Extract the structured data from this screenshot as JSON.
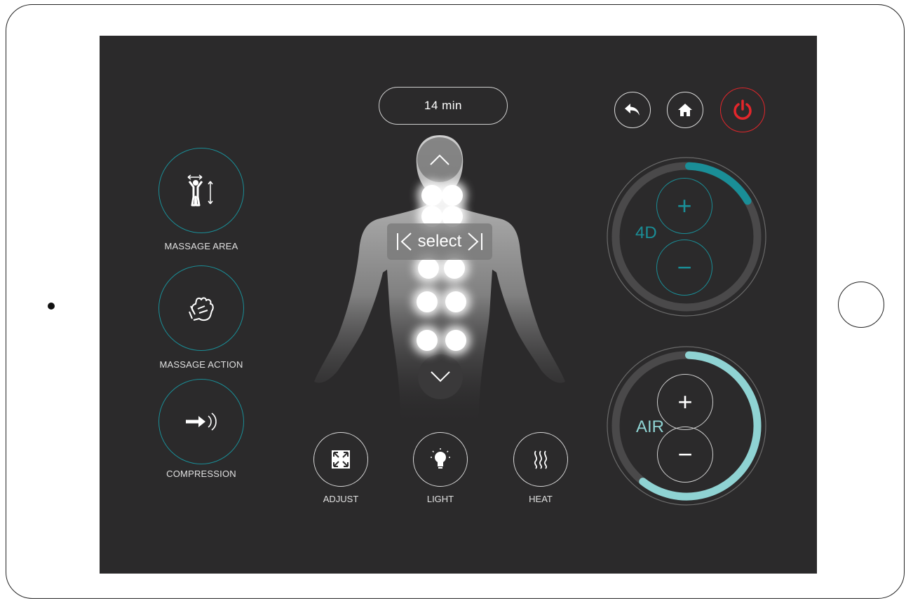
{
  "timer": {
    "label": "14 min"
  },
  "top_controls": {
    "back_icon": "back-arrow-icon",
    "home_icon": "home-icon",
    "power_icon": "power-icon",
    "power_color": "#e3262b"
  },
  "modes": [
    {
      "label": "MASSAGE AREA",
      "icon": "massage-area-icon"
    },
    {
      "label": "MASSAGE ACTION",
      "icon": "fist-icon"
    },
    {
      "label": "COMPRESSION",
      "icon": "compression-icon"
    }
  ],
  "body": {
    "select_label": "select",
    "up_icon": "chevron-up-icon",
    "down_icon": "chevron-down-icon"
  },
  "features": [
    {
      "label": "ADJUST",
      "icon": "expand-icon"
    },
    {
      "label": "LIGHT",
      "icon": "light-bulb-icon"
    },
    {
      "label": "HEAT",
      "icon": "heat-icon"
    }
  ],
  "dials": {
    "fourd": {
      "label": "4D",
      "color": "#1a8e97",
      "level_fraction": 0.16,
      "plus": "+",
      "minus": "−"
    },
    "air": {
      "label": "AIR",
      "color": "#8fd3d3",
      "level_fraction": 0.6,
      "plus": "+",
      "minus": "−"
    }
  },
  "accent": "#1a8e97"
}
